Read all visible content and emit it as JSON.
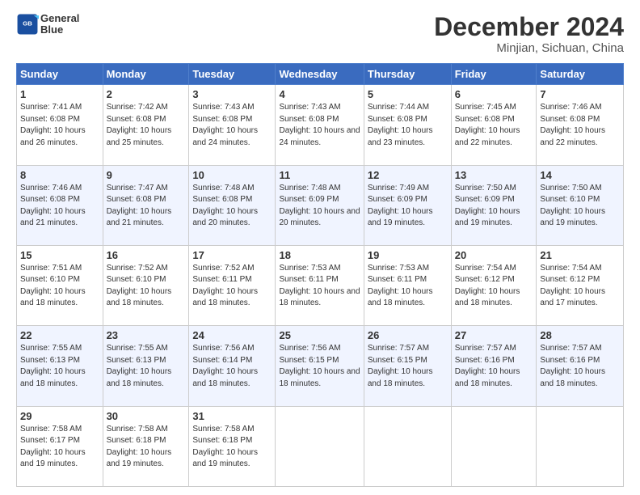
{
  "header": {
    "logo_line1": "General",
    "logo_line2": "Blue",
    "title": "December 2024",
    "subtitle": "Minjian, Sichuan, China"
  },
  "weekdays": [
    "Sunday",
    "Monday",
    "Tuesday",
    "Wednesday",
    "Thursday",
    "Friday",
    "Saturday"
  ],
  "weeks": [
    [
      {
        "day": "1",
        "rise": "Sunrise: 7:41 AM",
        "set": "Sunset: 6:08 PM",
        "daylight": "Daylight: 10 hours and 26 minutes."
      },
      {
        "day": "2",
        "rise": "Sunrise: 7:42 AM",
        "set": "Sunset: 6:08 PM",
        "daylight": "Daylight: 10 hours and 25 minutes."
      },
      {
        "day": "3",
        "rise": "Sunrise: 7:43 AM",
        "set": "Sunset: 6:08 PM",
        "daylight": "Daylight: 10 hours and 24 minutes."
      },
      {
        "day": "4",
        "rise": "Sunrise: 7:43 AM",
        "set": "Sunset: 6:08 PM",
        "daylight": "Daylight: 10 hours and 24 minutes."
      },
      {
        "day": "5",
        "rise": "Sunrise: 7:44 AM",
        "set": "Sunset: 6:08 PM",
        "daylight": "Daylight: 10 hours and 23 minutes."
      },
      {
        "day": "6",
        "rise": "Sunrise: 7:45 AM",
        "set": "Sunset: 6:08 PM",
        "daylight": "Daylight: 10 hours and 22 minutes."
      },
      {
        "day": "7",
        "rise": "Sunrise: 7:46 AM",
        "set": "Sunset: 6:08 PM",
        "daylight": "Daylight: 10 hours and 22 minutes."
      }
    ],
    [
      {
        "day": "8",
        "rise": "Sunrise: 7:46 AM",
        "set": "Sunset: 6:08 PM",
        "daylight": "Daylight: 10 hours and 21 minutes."
      },
      {
        "day": "9",
        "rise": "Sunrise: 7:47 AM",
        "set": "Sunset: 6:08 PM",
        "daylight": "Daylight: 10 hours and 21 minutes."
      },
      {
        "day": "10",
        "rise": "Sunrise: 7:48 AM",
        "set": "Sunset: 6:08 PM",
        "daylight": "Daylight: 10 hours and 20 minutes."
      },
      {
        "day": "11",
        "rise": "Sunrise: 7:48 AM",
        "set": "Sunset: 6:09 PM",
        "daylight": "Daylight: 10 hours and 20 minutes."
      },
      {
        "day": "12",
        "rise": "Sunrise: 7:49 AM",
        "set": "Sunset: 6:09 PM",
        "daylight": "Daylight: 10 hours and 19 minutes."
      },
      {
        "day": "13",
        "rise": "Sunrise: 7:50 AM",
        "set": "Sunset: 6:09 PM",
        "daylight": "Daylight: 10 hours and 19 minutes."
      },
      {
        "day": "14",
        "rise": "Sunrise: 7:50 AM",
        "set": "Sunset: 6:10 PM",
        "daylight": "Daylight: 10 hours and 19 minutes."
      }
    ],
    [
      {
        "day": "15",
        "rise": "Sunrise: 7:51 AM",
        "set": "Sunset: 6:10 PM",
        "daylight": "Daylight: 10 hours and 18 minutes."
      },
      {
        "day": "16",
        "rise": "Sunrise: 7:52 AM",
        "set": "Sunset: 6:10 PM",
        "daylight": "Daylight: 10 hours and 18 minutes."
      },
      {
        "day": "17",
        "rise": "Sunrise: 7:52 AM",
        "set": "Sunset: 6:11 PM",
        "daylight": "Daylight: 10 hours and 18 minutes."
      },
      {
        "day": "18",
        "rise": "Sunrise: 7:53 AM",
        "set": "Sunset: 6:11 PM",
        "daylight": "Daylight: 10 hours and 18 minutes."
      },
      {
        "day": "19",
        "rise": "Sunrise: 7:53 AM",
        "set": "Sunset: 6:11 PM",
        "daylight": "Daylight: 10 hours and 18 minutes."
      },
      {
        "day": "20",
        "rise": "Sunrise: 7:54 AM",
        "set": "Sunset: 6:12 PM",
        "daylight": "Daylight: 10 hours and 18 minutes."
      },
      {
        "day": "21",
        "rise": "Sunrise: 7:54 AM",
        "set": "Sunset: 6:12 PM",
        "daylight": "Daylight: 10 hours and 17 minutes."
      }
    ],
    [
      {
        "day": "22",
        "rise": "Sunrise: 7:55 AM",
        "set": "Sunset: 6:13 PM",
        "daylight": "Daylight: 10 hours and 18 minutes."
      },
      {
        "day": "23",
        "rise": "Sunrise: 7:55 AM",
        "set": "Sunset: 6:13 PM",
        "daylight": "Daylight: 10 hours and 18 minutes."
      },
      {
        "day": "24",
        "rise": "Sunrise: 7:56 AM",
        "set": "Sunset: 6:14 PM",
        "daylight": "Daylight: 10 hours and 18 minutes."
      },
      {
        "day": "25",
        "rise": "Sunrise: 7:56 AM",
        "set": "Sunset: 6:15 PM",
        "daylight": "Daylight: 10 hours and 18 minutes."
      },
      {
        "day": "26",
        "rise": "Sunrise: 7:57 AM",
        "set": "Sunset: 6:15 PM",
        "daylight": "Daylight: 10 hours and 18 minutes."
      },
      {
        "day": "27",
        "rise": "Sunrise: 7:57 AM",
        "set": "Sunset: 6:16 PM",
        "daylight": "Daylight: 10 hours and 18 minutes."
      },
      {
        "day": "28",
        "rise": "Sunrise: 7:57 AM",
        "set": "Sunset: 6:16 PM",
        "daylight": "Daylight: 10 hours and 18 minutes."
      }
    ],
    [
      {
        "day": "29",
        "rise": "Sunrise: 7:58 AM",
        "set": "Sunset: 6:17 PM",
        "daylight": "Daylight: 10 hours and 19 minutes."
      },
      {
        "day": "30",
        "rise": "Sunrise: 7:58 AM",
        "set": "Sunset: 6:18 PM",
        "daylight": "Daylight: 10 hours and 19 minutes."
      },
      {
        "day": "31",
        "rise": "Sunrise: 7:58 AM",
        "set": "Sunset: 6:18 PM",
        "daylight": "Daylight: 10 hours and 19 minutes."
      },
      null,
      null,
      null,
      null
    ]
  ]
}
